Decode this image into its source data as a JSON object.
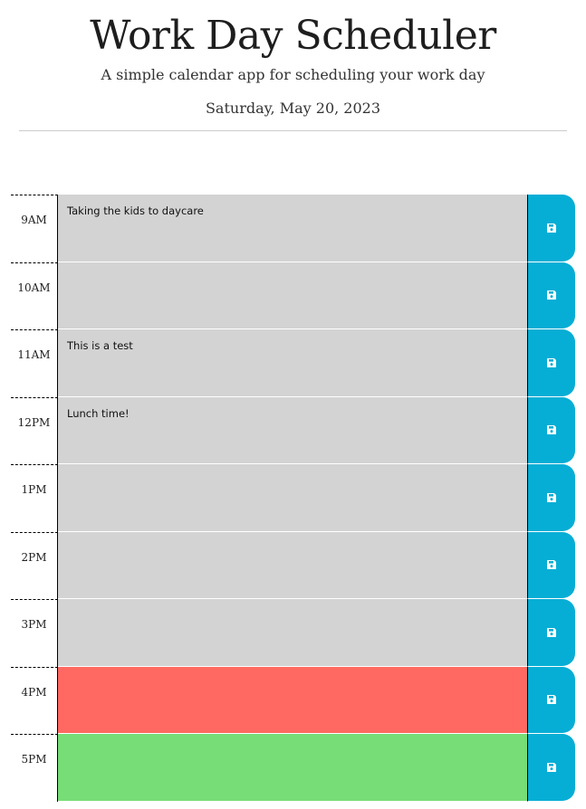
{
  "header": {
    "title": "Work Day Scheduler",
    "subtitle": "A simple calendar app for scheduling your work day",
    "date": "Saturday, May 20, 2023"
  },
  "schedule": {
    "rows": [
      {
        "hour": "9AM",
        "text": "Taking the kids to daycare",
        "status": "past"
      },
      {
        "hour": "10AM",
        "text": "",
        "status": "past"
      },
      {
        "hour": "11AM",
        "text": "This is a test",
        "status": "past"
      },
      {
        "hour": "12PM",
        "text": "Lunch time!",
        "status": "past"
      },
      {
        "hour": "1PM",
        "text": "",
        "status": "past"
      },
      {
        "hour": "2PM",
        "text": "",
        "status": "past"
      },
      {
        "hour": "3PM",
        "text": "",
        "status": "past"
      },
      {
        "hour": "4PM",
        "text": "",
        "status": "present"
      },
      {
        "hour": "5PM",
        "text": "",
        "status": "future"
      }
    ],
    "save_icon": "save-icon"
  },
  "colors": {
    "past": "#d3d3d3",
    "present": "#ff6961",
    "future": "#77dd77",
    "save_button": "#06aed5"
  }
}
